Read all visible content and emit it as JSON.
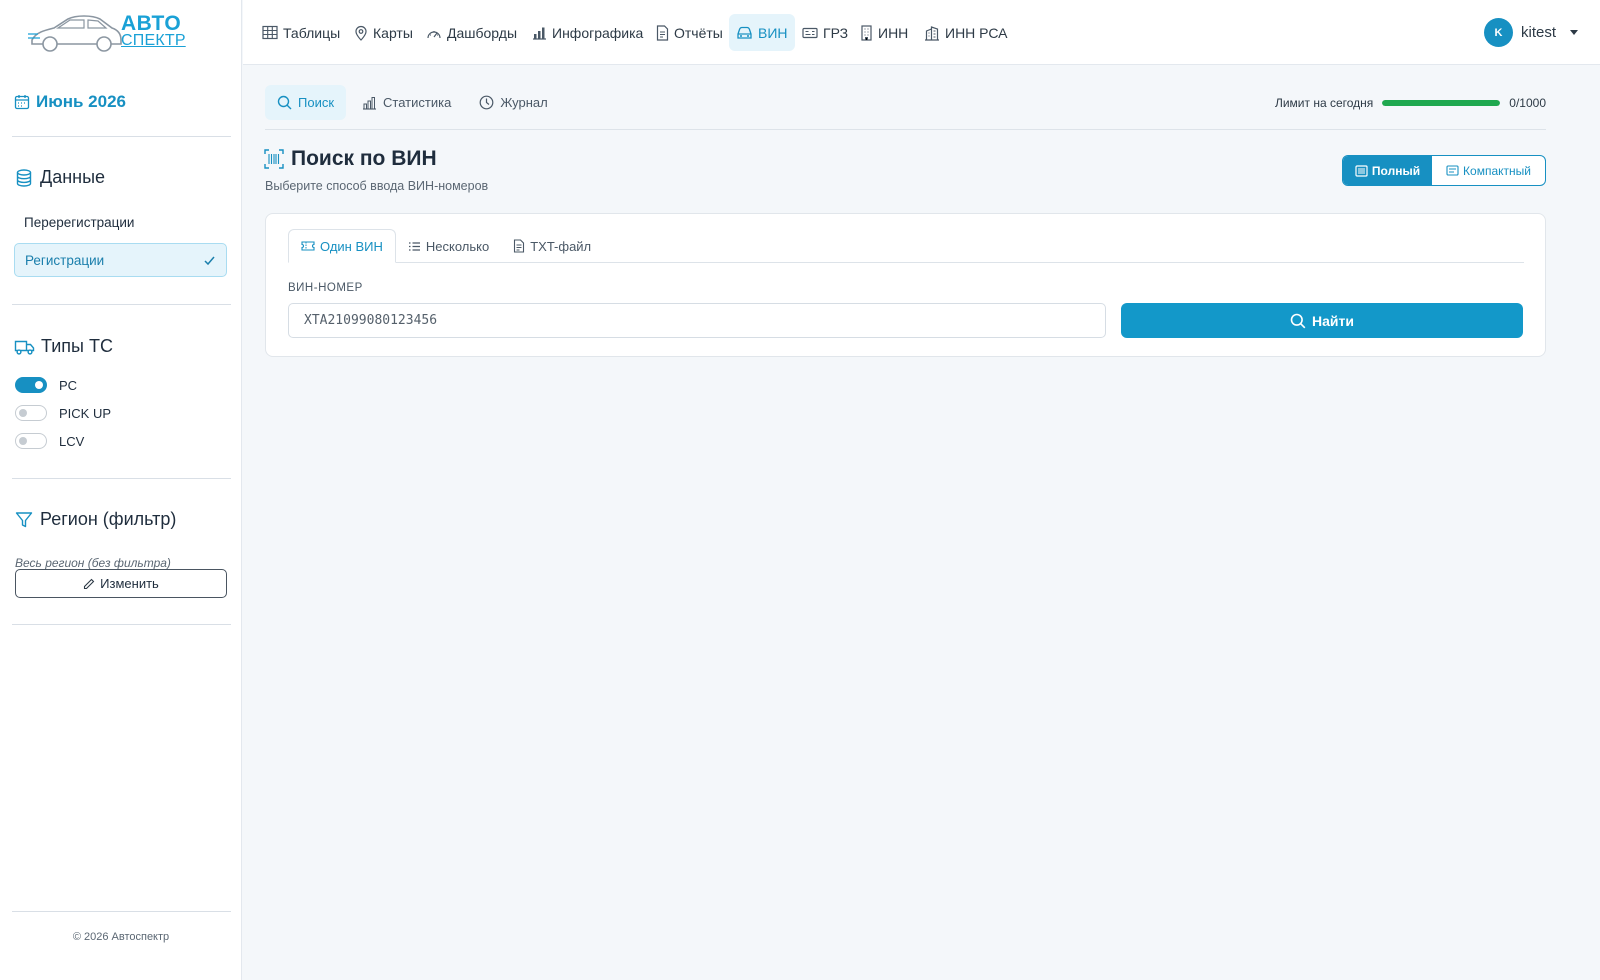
{
  "brand": {
    "line1": "АВТО",
    "line2": "СПЕКТР"
  },
  "nav": {
    "items": [
      {
        "label": "Таблицы",
        "icon": "table-icon"
      },
      {
        "label": "Карты",
        "icon": "map-pin-icon"
      },
      {
        "label": "Дашборды",
        "icon": "speedometer-icon"
      },
      {
        "label": "Инфографика",
        "icon": "bar-chart-icon"
      },
      {
        "label": "Отчёты",
        "icon": "document-icon"
      },
      {
        "label": "ВИН",
        "icon": "car-icon",
        "active": true
      },
      {
        "label": "ГРЗ",
        "icon": "plate-icon"
      },
      {
        "label": "ИНН",
        "icon": "building-icon"
      },
      {
        "label": "ИНН РСА",
        "icon": "buildings-icon"
      }
    ]
  },
  "user": {
    "initial": "K",
    "name": "kitest"
  },
  "sidebar": {
    "month": "Июнь 2026",
    "data_title": "Данные",
    "data_items": [
      {
        "label": "Перерегистрации",
        "active": false
      },
      {
        "label": "Регистрации",
        "active": true
      }
    ],
    "types_title": "Типы ТС",
    "types": [
      {
        "label": "PC",
        "on": true
      },
      {
        "label": "PICK UP",
        "on": false
      },
      {
        "label": "LCV",
        "on": false
      }
    ],
    "region_title": "Регион (фильтр)",
    "region_note": "Весь регион (без фильтра)",
    "change_label": "Изменить",
    "copyright": "© 2026 Автоспектр"
  },
  "subtabs": [
    {
      "label": "Поиск",
      "active": true
    },
    {
      "label": "Статистика",
      "active": false
    },
    {
      "label": "Журнал",
      "active": false
    }
  ],
  "limit": {
    "label": "Лимит на сегодня",
    "value": "0/1000",
    "fill_percent": 100
  },
  "page": {
    "title": "Поиск по ВИН",
    "subtitle": "Выберите способ ввода ВИН-номеров"
  },
  "view_toggle": {
    "full": "Полный",
    "compact": "Компактный"
  },
  "card": {
    "tabs": [
      {
        "label": "Один ВИН",
        "active": true
      },
      {
        "label": "Несколько",
        "active": false
      },
      {
        "label": "TXT-файл",
        "active": false
      }
    ],
    "field_label": "ВИН-НОМЕР",
    "vin_value": "XTA21099080123456",
    "find_label": "Найти"
  },
  "colors": {
    "accent": "#1790c2",
    "button": "#1398c9",
    "limit_fill": "#1fa84f"
  }
}
